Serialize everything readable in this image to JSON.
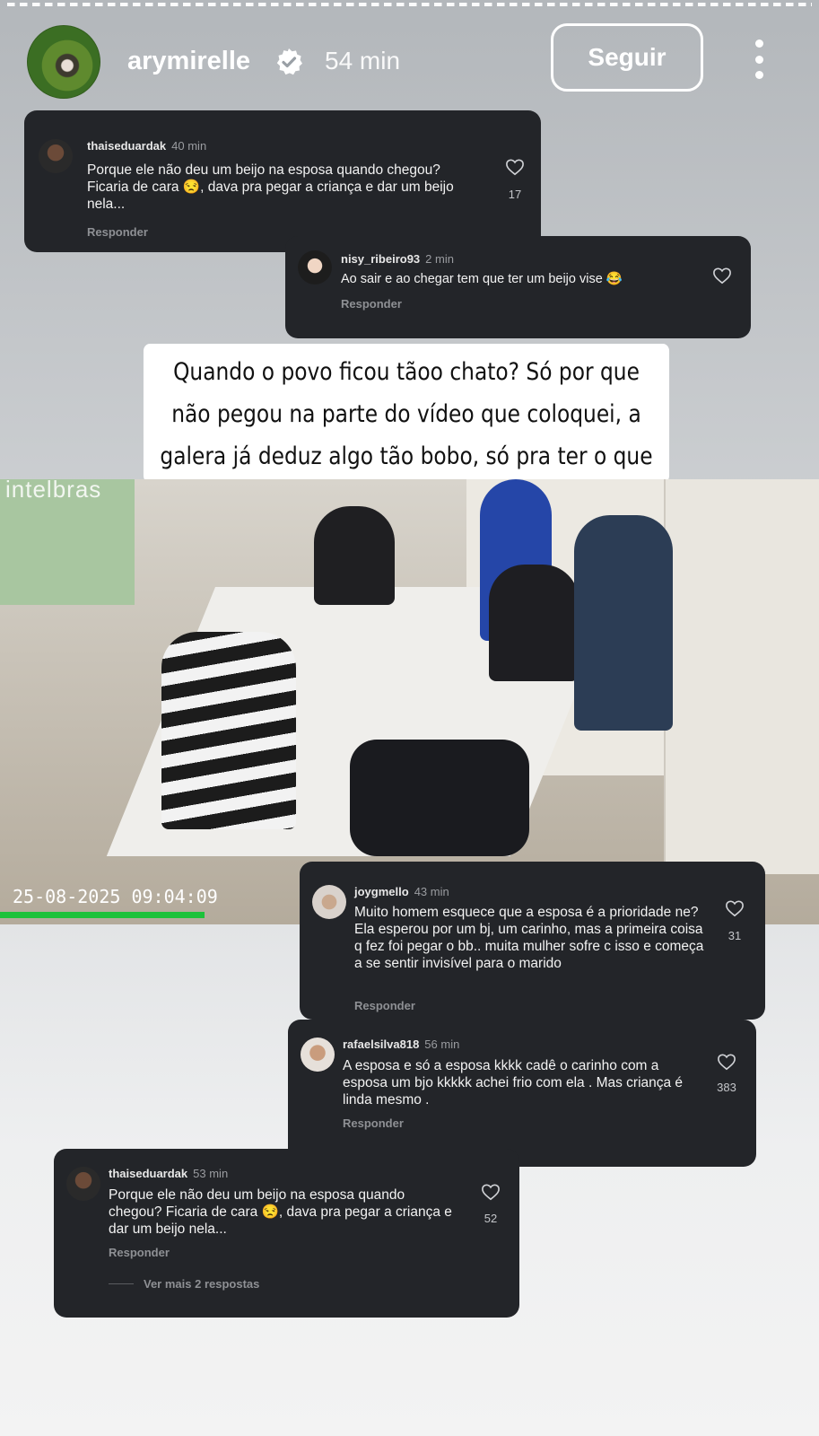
{
  "story": {
    "username": "arymirelle",
    "time": "54 min",
    "follow_label": "Seguir",
    "caption": "Quando o povo ficou tãoo chato? Só por que não pegou na parte do vídeo que coloquei, a galera já deduz algo tão bobo, só pra ter o que falar"
  },
  "video": {
    "brand": "intelbras",
    "timestamp": "25-08-2025 09:04:09",
    "progress": 0.25
  },
  "comments": [
    {
      "username": "thaiseduardak",
      "time": "40 min",
      "text": "Porque ele não deu um beijo na esposa quando chegou? Ficaria de cara 😒, dava pra pegar a criança e dar um beijo nela...",
      "likes": "17",
      "reply": "Responder"
    },
    {
      "username": "nisy_ribeiro93",
      "time": "2 min",
      "text": "Ao sair e ao chegar tem que ter um beijo vise 😂",
      "reply": "Responder"
    },
    {
      "username": "joygmello",
      "time": "43 min",
      "text": "Muito homem esquece que a esposa é a prioridade ne? Ela esperou por um bj, um carinho, mas a primeira coisa q fez foi pegar o bb.. muita mulher sofre c isso e começa a se sentir invisível para o marido",
      "likes": "31",
      "reply": "Responder"
    },
    {
      "username": "rafaelsilva818",
      "time": "56 min",
      "text": "A esposa e só a esposa kkkk cadê o carinho com a esposa um bjo kkkkk achei frio com ela . Mas criança é linda mesmo .",
      "likes": "383",
      "reply": "Responder"
    },
    {
      "username": "thaiseduardak",
      "time": "53 min",
      "text": "Porque ele não deu um beijo na esposa quando chegou? Ficaria de cara 😒, dava pra pegar a criança e dar um beijo nela...",
      "likes": "52",
      "reply": "Responder",
      "more_replies": "Ver mais 2 respostas"
    }
  ],
  "icons": {
    "verified": "verified-badge-icon",
    "more": "more-vertical-icon",
    "like": "heart-icon"
  }
}
